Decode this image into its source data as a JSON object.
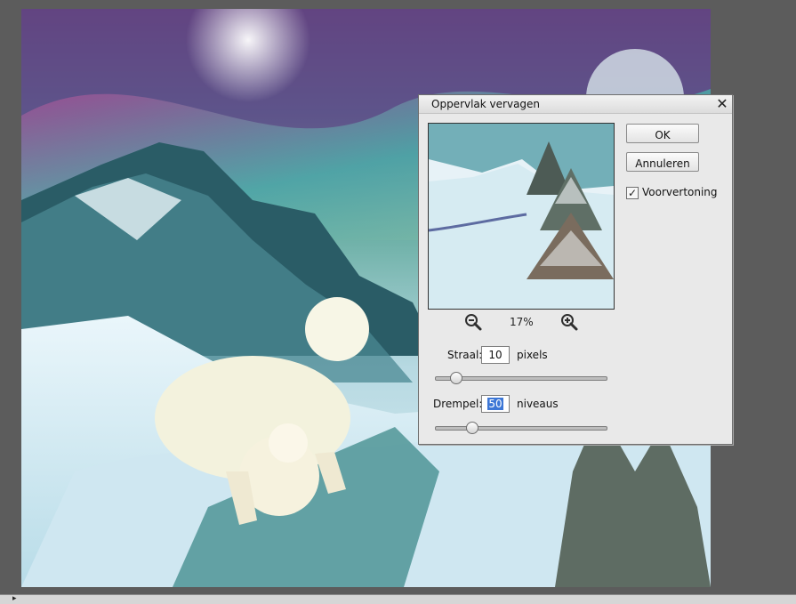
{
  "dialog": {
    "title": "Oppervlak vervagen",
    "ok_label": "OK",
    "cancel_label": "Annuleren",
    "preview_label": "Voorvertoning",
    "preview_checked": true,
    "zoom_level": "17%",
    "radius": {
      "label": "Straal:",
      "value": "10",
      "unit": "pixels",
      "slider_fraction": 0.09
    },
    "threshold": {
      "label": "Drempel:",
      "value": "50",
      "unit": "niveaus",
      "slider_fraction": 0.19
    }
  },
  "icons": {
    "close": "close-icon",
    "zoom_out": "zoom-out-icon",
    "zoom_in": "zoom-in-icon",
    "checkbox": "check-icon"
  },
  "colors": {
    "workspace_bg": "#5c5c5c",
    "dialog_bg": "#e9e9e9",
    "selection": "#3d77d6"
  }
}
